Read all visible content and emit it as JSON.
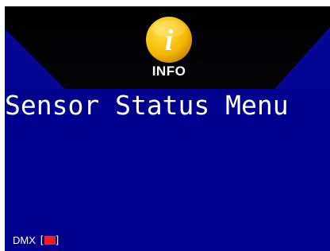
{
  "header": {
    "icon": "info-icon",
    "icon_glyph": "i",
    "label": "INFO",
    "colors": {
      "badge": "#f5b800",
      "band": "#000000"
    }
  },
  "title": "Sensor Status Menu",
  "footer": {
    "dmx_label": "DMX",
    "bracket_open": "[",
    "bracket_close": "]",
    "status_color": "#ff1a1a"
  },
  "colors": {
    "background": "#00008f",
    "text": "#ffffff"
  }
}
